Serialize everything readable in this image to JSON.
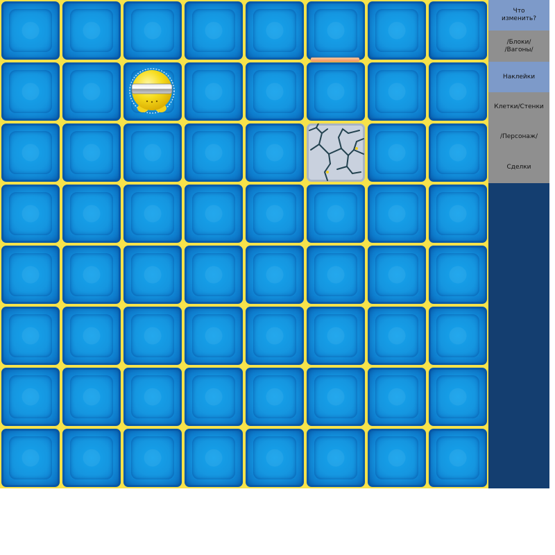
{
  "game": {
    "grid_rows": 8,
    "grid_cols": 8,
    "character": {
      "name": "yellow-robot",
      "row": 1,
      "col": 2
    },
    "cracked_cell": {
      "row": 2,
      "col": 5
    },
    "wall": {
      "row": 1,
      "col": 5,
      "side": "top"
    }
  },
  "sidebar": {
    "items": [
      {
        "label": "Что\nизменить?",
        "style": "blue"
      },
      {
        "label": "/Блоки/\n/Вагоны/",
        "style": "gray"
      },
      {
        "label": "Наклейки",
        "style": "blue"
      },
      {
        "label": "Клетки/Стенки",
        "style": "gray"
      },
      {
        "label": "/Персонаж/",
        "style": "gray"
      },
      {
        "label": "Сделки",
        "style": "gray"
      }
    ]
  },
  "colors": {
    "board_border": "#f7e24a",
    "tile_blue": "#1596e0",
    "sidebar_bg": "#143e70",
    "menu_blue": "#7d9ac9",
    "menu_gray": "#8f8f8f"
  }
}
